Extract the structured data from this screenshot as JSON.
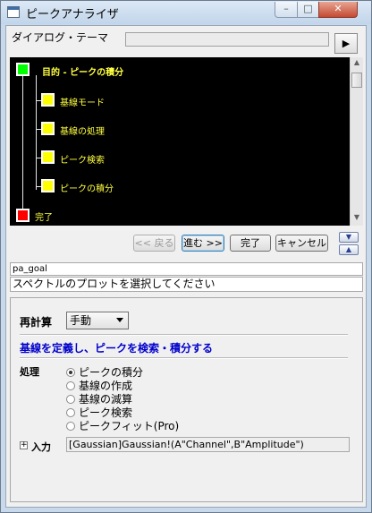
{
  "window": {
    "title": "ピークアナライザ"
  },
  "theme": {
    "label": "ダイアログ・テーマ",
    "value": ""
  },
  "flowchart": {
    "goal": "目的 - ピークの積分",
    "steps": [
      "基線モード",
      "基線の処理",
      "ピーク検索",
      "ピークの積分"
    ],
    "done": "完了",
    "colors": {
      "goal": "#00ff00",
      "step": "#ffff00",
      "done": "#ff0000",
      "label": "#ffff40"
    }
  },
  "nav": {
    "back": "<< 戻る",
    "next": "進む >>",
    "finish": "完了",
    "cancel": "キャンセル"
  },
  "page": {
    "name": "pa_goal",
    "description": "スペクトルのプロットを選択してください"
  },
  "recalc": {
    "label": "再計算",
    "value": "手動"
  },
  "section": {
    "heading": "基線を定義し、ピークを検索・積分する"
  },
  "process": {
    "label": "処理",
    "options": [
      "ピークの積分",
      "基線の作成",
      "基線の減算",
      "ピーク検索",
      "ピークフィット(Pro)"
    ],
    "selected": 0
  },
  "input": {
    "label": "入力",
    "value": "[Gaussian]Gaussian!(A\"Channel\",B\"Amplitude\")"
  }
}
